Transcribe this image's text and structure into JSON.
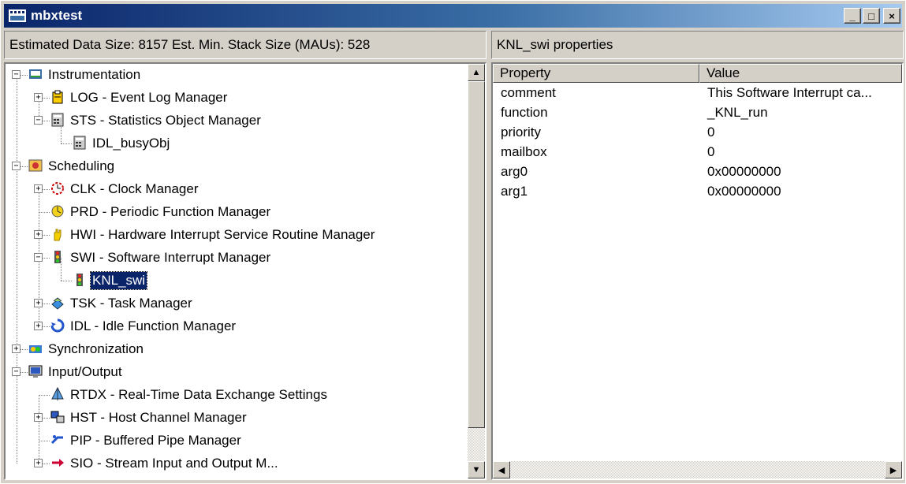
{
  "window": {
    "title": "mbxtest",
    "buttons": {
      "minimize": "_",
      "maximize": "□",
      "close": "×"
    }
  },
  "left_header": "Estimated Data Size: 8157   Est. Min. Stack Size (MAUs): 528",
  "right_header": "KNL_swi properties",
  "tree": [
    {
      "label": "Instrumentation",
      "icon": "instrumentation-icon",
      "exp": "−"
    },
    {
      "label": "LOG - Event Log Manager",
      "icon": "log-icon",
      "exp": "+"
    },
    {
      "label": "STS - Statistics Object Manager",
      "icon": "calculator-icon",
      "exp": "−"
    },
    {
      "label": "IDL_busyObj",
      "icon": "calculator-icon",
      "exp": ""
    },
    {
      "label": "Scheduling",
      "icon": "scheduling-icon",
      "exp": "−"
    },
    {
      "label": "CLK - Clock Manager",
      "icon": "clock-icon",
      "exp": "+"
    },
    {
      "label": "PRD - Periodic Function Manager",
      "icon": "periodic-icon",
      "exp": ""
    },
    {
      "label": "HWI - Hardware Interrupt Service Routine Manager",
      "icon": "hand-icon",
      "exp": "+"
    },
    {
      "label": "SWI - Software Interrupt Manager",
      "icon": "traffic-light-icon",
      "exp": "−"
    },
    {
      "label": "KNL_swi",
      "icon": "traffic-light-icon",
      "exp": "",
      "selected": true
    },
    {
      "label": "TSK - Task Manager",
      "icon": "task-icon",
      "exp": "+"
    },
    {
      "label": "IDL - Idle Function Manager",
      "icon": "idle-icon",
      "exp": "+"
    },
    {
      "label": "Synchronization",
      "icon": "synchronization-icon",
      "exp": "+"
    },
    {
      "label": "Input/Output",
      "icon": "monitor-icon",
      "exp": "−"
    },
    {
      "label": "RTDX - Real-Time Data Exchange Settings",
      "icon": "rtdx-icon",
      "exp": ""
    },
    {
      "label": "HST - Host Channel Manager",
      "icon": "host-icon",
      "exp": "+"
    },
    {
      "label": "PIP - Buffered Pipe Manager",
      "icon": "pipe-icon",
      "exp": ""
    },
    {
      "label": "SIO - Stream Input and Output M...",
      "icon": "stream-icon",
      "exp": "+"
    }
  ],
  "properties": {
    "columns": [
      "Property",
      "Value"
    ],
    "rows": [
      [
        "comment",
        "This Software Interrupt ca..."
      ],
      [
        "function",
        "_KNL_run"
      ],
      [
        "priority",
        "0"
      ],
      [
        "mailbox",
        "0"
      ],
      [
        "arg0",
        "0x00000000"
      ],
      [
        "arg1",
        "0x00000000"
      ]
    ]
  },
  "scroll": {
    "up": "▲",
    "down": "▼",
    "left": "◀",
    "right": "▶"
  },
  "colors": {
    "title_start": "#0a246a",
    "title_end": "#a6caf0",
    "face": "#d4d0c8",
    "selection": "#0a246a"
  }
}
